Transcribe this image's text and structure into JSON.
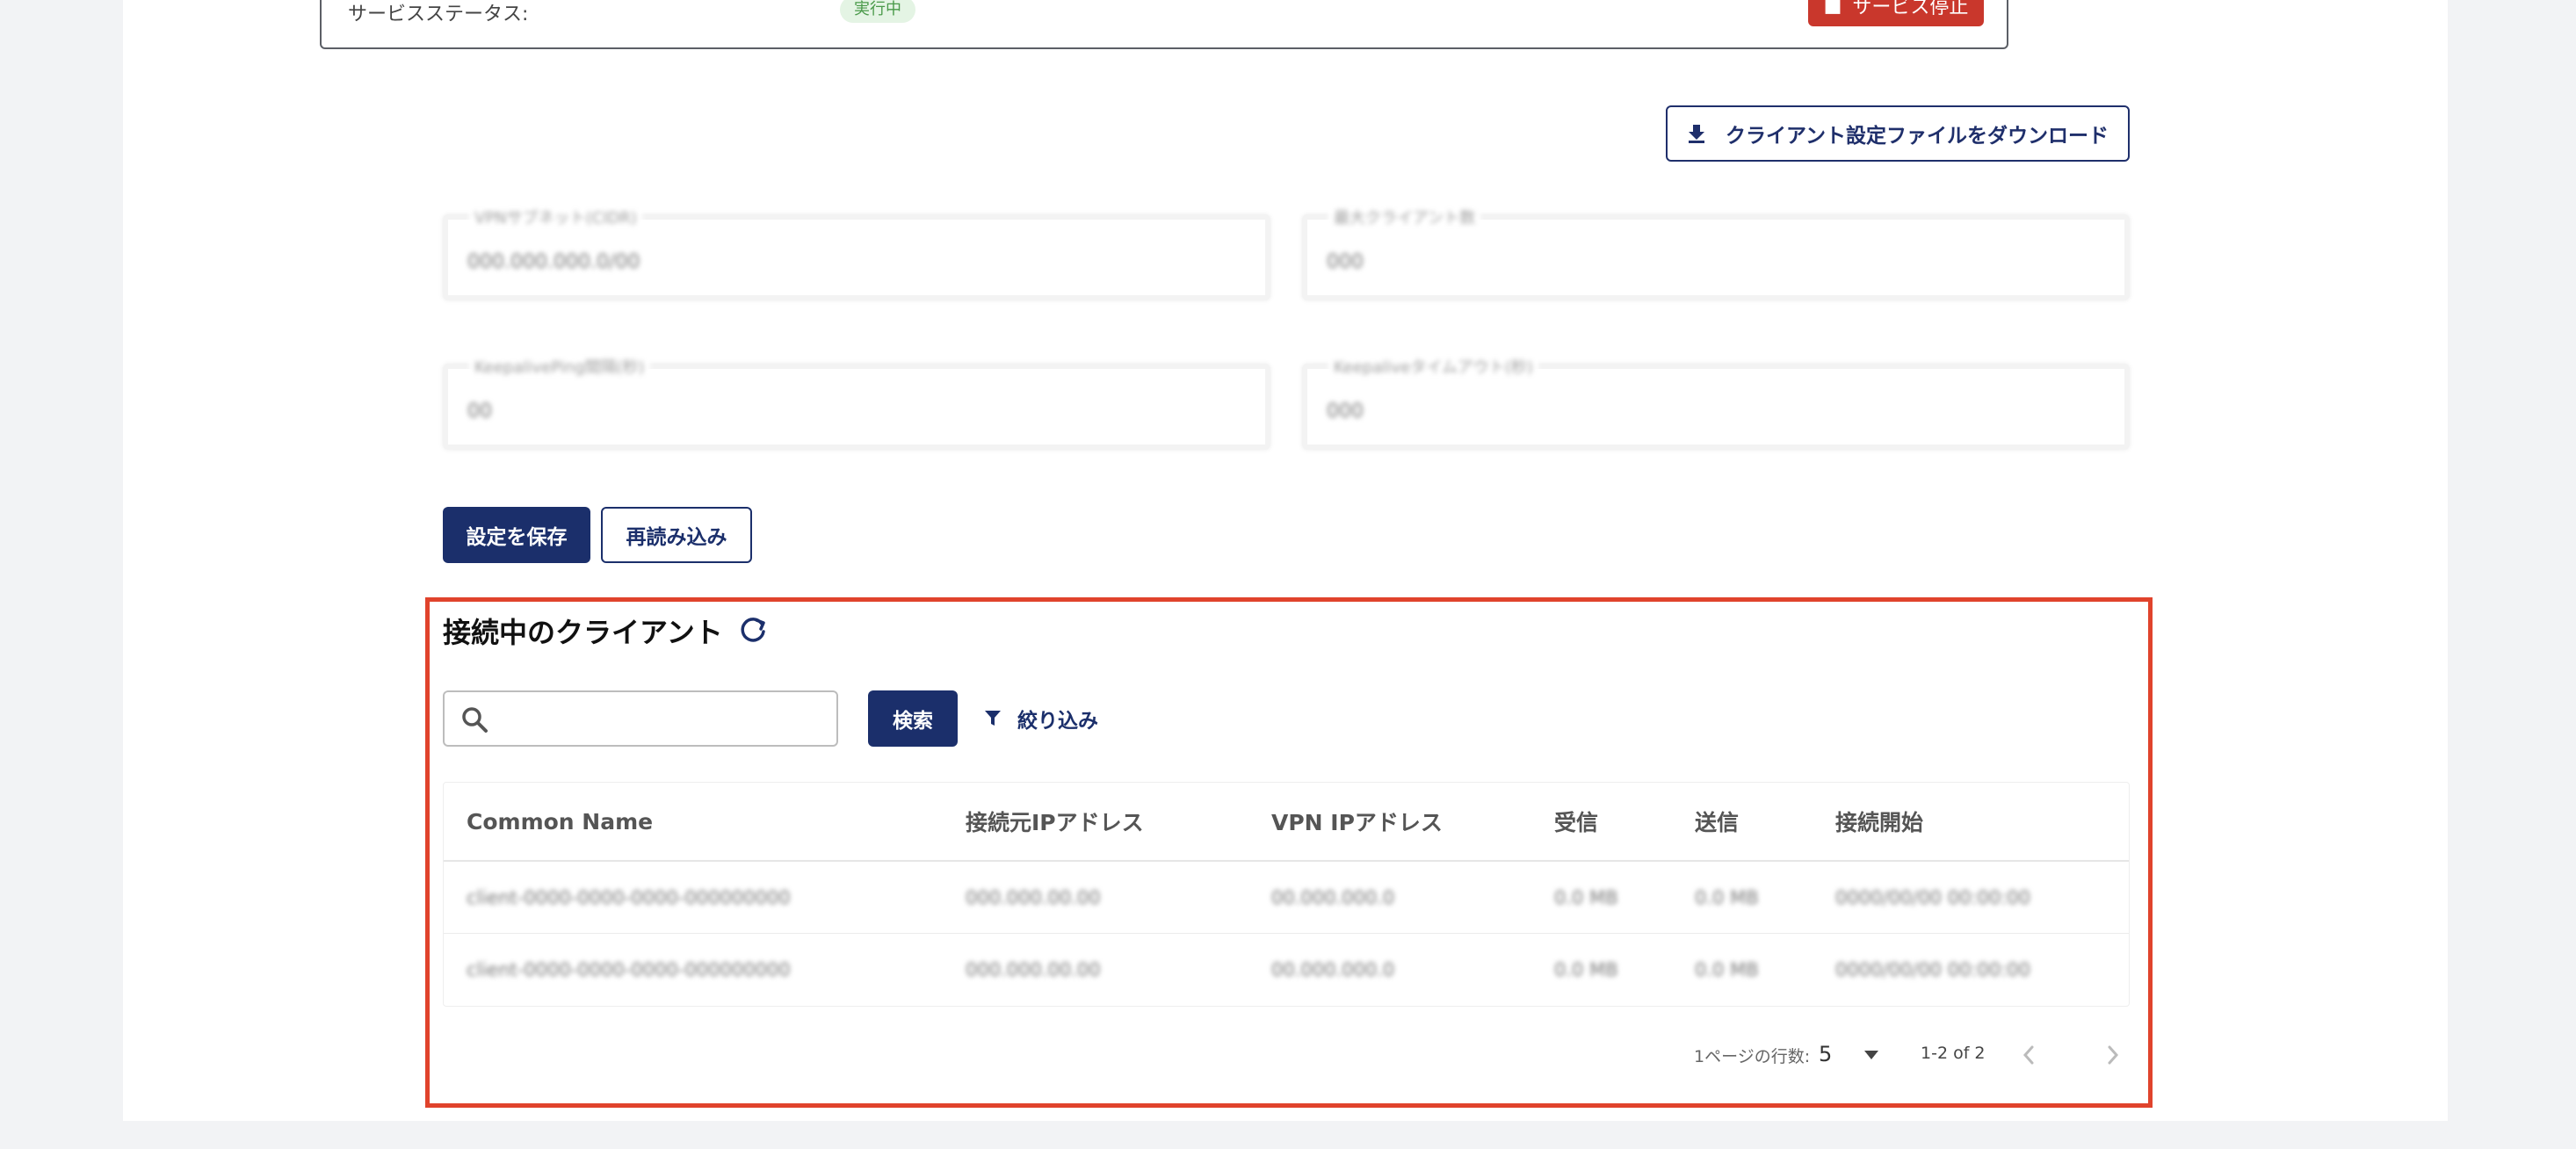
{
  "status": {
    "label": "サービスステータス:",
    "badge": "実行中",
    "stop_label": "サービス停止"
  },
  "download_label": "クライアント設定ファイルをダウンロード",
  "fields": [
    {
      "label": "VPNサブネット(CIDR)",
      "value": "000.000.000.0/00"
    },
    {
      "label": "最大クライアント数",
      "value": "000"
    },
    {
      "label": "KeepalivePing間隔(秒)",
      "value": "00"
    },
    {
      "label": "Keepaliveタイムアウト(秒)",
      "value": "000"
    }
  ],
  "buttons": {
    "save": "設定を保存",
    "reload": "再読み込み",
    "search": "検索",
    "filter": "絞り込み"
  },
  "clients": {
    "title": "接続中のクライアント",
    "search_placeholder": "",
    "columns": [
      "Common Name",
      "接続元IPアドレス",
      "VPN IPアドレス",
      "受信",
      "送信",
      "接続開始"
    ],
    "rows": [
      [
        "client-0000-0000-0000-000000000",
        "000.000.00.00",
        "00.000.000.0",
        "0.0 MB",
        "0.0 MB",
        "0000/00/00 00:00:00"
      ],
      [
        "client-0000-0000-0000-000000000",
        "000.000.00.00",
        "00.000.000.0",
        "0.0 MB",
        "0.0 MB",
        "0000/00/00 00:00:00"
      ]
    ],
    "rows_per_page_label": "1ページの行数:",
    "rows_per_page": "5",
    "range": "1-2 of 2"
  }
}
